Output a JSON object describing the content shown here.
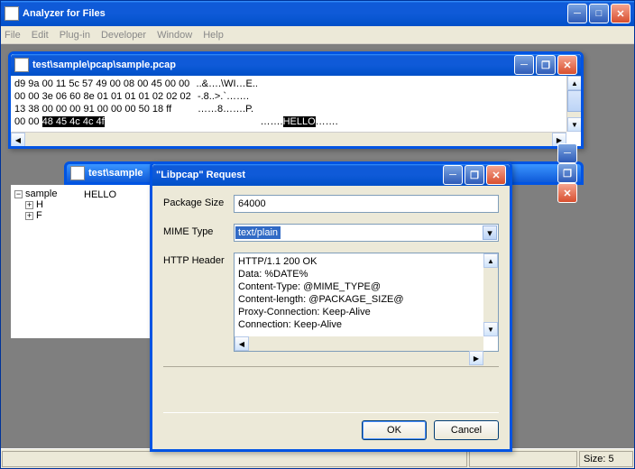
{
  "main": {
    "title": "Analyzer for Files",
    "menu": [
      "File",
      "Edit",
      "Plug-in",
      "Developer",
      "Window",
      "Help"
    ],
    "status_size_label": "Size: 5"
  },
  "hex": {
    "title": "test\\sample\\pcap\\sample.pcap",
    "lines": [
      {
        "hex": "d9 9a 00 11 5c 57 49 00 08 00 45 00 00",
        "ascii": "..&….\\WI…E.."
      },
      {
        "hex": "00 00 3e 06 60 8e 01 01 01 01 02 02 02",
        "ascii": "-.8..>.`……."
      },
      {
        "hex": "13 38 00 00 00 91 00 00 00 50 18 ff",
        "ascii": "……8…….P."
      },
      {
        "hex": "00 00 ",
        "hl_hex": "48 45 4c 4c 4f",
        "ascii_pre": "…….",
        "ascii_hl": "HELLO",
        "ascii_post": "……."
      }
    ]
  },
  "tree": {
    "title_partial": "test\\sample",
    "root": "sample",
    "children": [
      "H",
      "F"
    ],
    "content": "HELLO"
  },
  "dialog": {
    "title": "\"Libpcap\" Request",
    "package_size_label": "Package Size",
    "package_size_value": "64000",
    "mime_label": "MIME Type",
    "mime_value": "text/plain",
    "http_label": "HTTP Header",
    "http_value": "HTTP/1.1 200 OK\nData: %DATE%\nContent-Type: @MIME_TYPE@\nContent-length: @PACKAGE_SIZE@\nProxy-Connection: Keep-Alive\nConnection: Keep-Alive",
    "ok": "OK",
    "cancel": "Cancel"
  }
}
